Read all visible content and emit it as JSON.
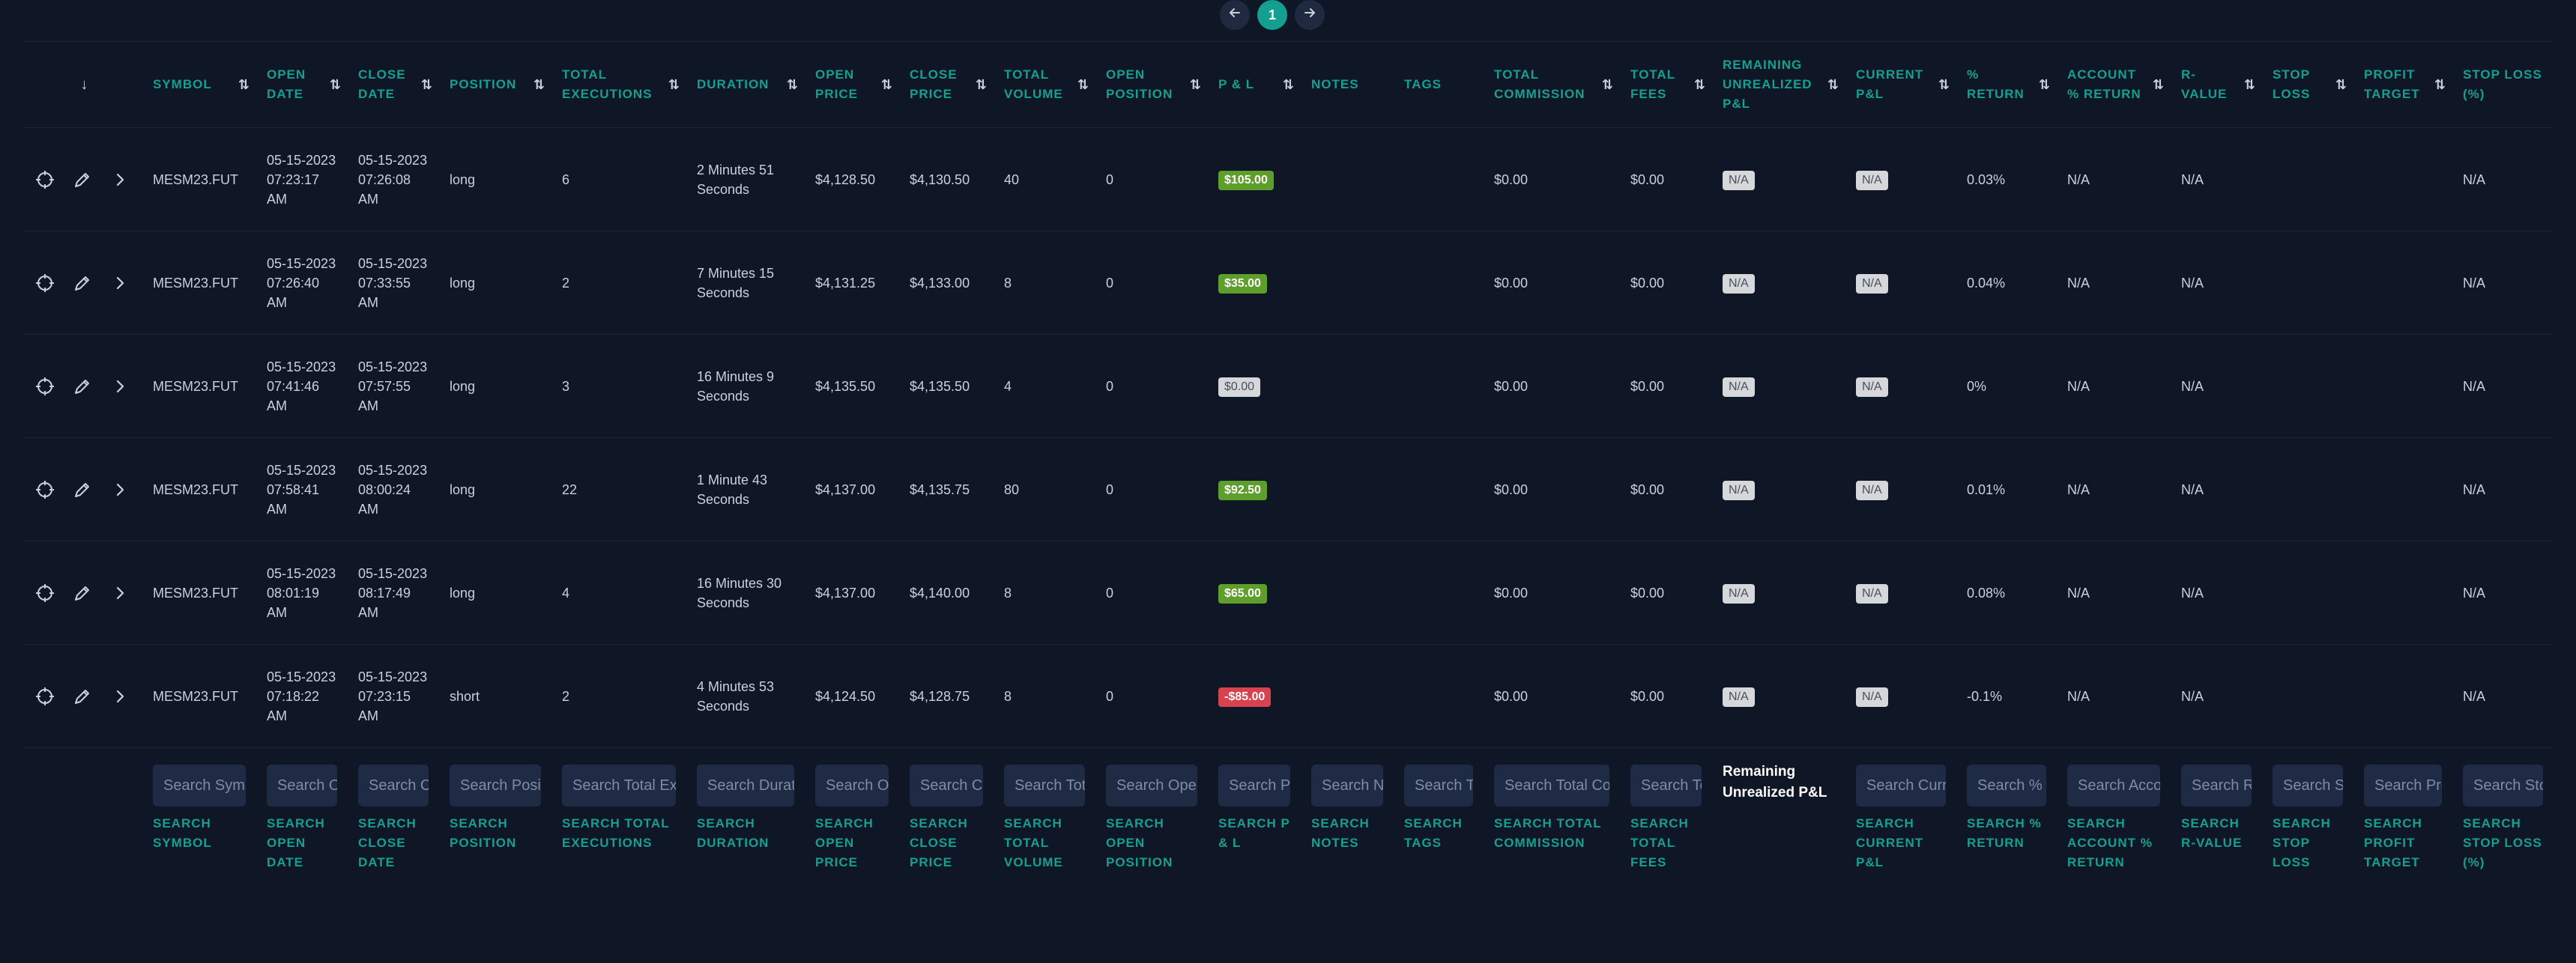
{
  "pagination": {
    "current": "1"
  },
  "sort_header_arrow": "↓",
  "columns": [
    {
      "key": "symbol",
      "label": "SYMBOL",
      "sortable": true,
      "search_placeholder": "Search Symbol",
      "search_label": "SEARCH SYMBOL"
    },
    {
      "key": "open_date",
      "label": "OPEN DATE",
      "sortable": true,
      "search_placeholder": "Search Open Date",
      "search_label": "SEARCH OPEN DATE"
    },
    {
      "key": "close_date",
      "label": "CLOSE DATE",
      "sortable": true,
      "search_placeholder": "Search Close Date",
      "search_label": "SEARCH CLOSE DATE"
    },
    {
      "key": "position",
      "label": "POSITION",
      "sortable": true,
      "search_placeholder": "Search Position",
      "search_label": "SEARCH POSITION"
    },
    {
      "key": "total_executions",
      "label": "TOTAL EXECUTIONS",
      "sortable": true,
      "search_placeholder": "Search Total Executions",
      "search_label": "SEARCH TOTAL EXECUTIONS"
    },
    {
      "key": "duration",
      "label": "DURATION",
      "sortable": true,
      "search_placeholder": "Search Duration",
      "search_label": "SEARCH DURATION"
    },
    {
      "key": "open_price",
      "label": "OPEN PRICE",
      "sortable": true,
      "search_placeholder": "Search Open Price",
      "search_label": "SEARCH OPEN PRICE"
    },
    {
      "key": "close_price",
      "label": "CLOSE PRICE",
      "sortable": true,
      "search_placeholder": "Search Close Price",
      "search_label": "SEARCH CLOSE PRICE"
    },
    {
      "key": "total_volume",
      "label": "TOTAL VOLUME",
      "sortable": true,
      "search_placeholder": "Search Total Volume",
      "search_label": "SEARCH TOTAL VOLUME"
    },
    {
      "key": "open_position",
      "label": "OPEN POSITION",
      "sortable": true,
      "search_placeholder": "Search Open Position",
      "search_label": "SEARCH OPEN POSITION"
    },
    {
      "key": "pnl",
      "label": "P & L",
      "sortable": true,
      "search_placeholder": "Search P & L",
      "search_label": "SEARCH P & L"
    },
    {
      "key": "notes",
      "label": "NOTES",
      "sortable": false,
      "search_placeholder": "Search Notes",
      "search_label": "SEARCH NOTES"
    },
    {
      "key": "tags",
      "label": "TAGS",
      "sortable": false,
      "search_placeholder": "Search Tags",
      "search_label": "SEARCH TAGS"
    },
    {
      "key": "total_commission",
      "label": "TOTAL COMMISSION",
      "sortable": true,
      "search_placeholder": "Search Total Commission",
      "search_label": "SEARCH TOTAL COMMISSION"
    },
    {
      "key": "total_fees",
      "label": "TOTAL FEES",
      "sortable": true,
      "search_placeholder": "Search Total Fees",
      "search_label": "SEARCH TOTAL FEES"
    },
    {
      "key": "remaining_unrealized_pnl",
      "label": "REMAINING UNREALIZED P&L",
      "sortable": true,
      "search_static": "Remaining Unrealized P&L"
    },
    {
      "key": "current_pnl",
      "label": "CURRENT P&L",
      "sortable": true,
      "search_placeholder": "Search Current P&L",
      "search_label": "SEARCH CURRENT P&L"
    },
    {
      "key": "pct_return",
      "label": "% RETURN",
      "sortable": true,
      "search_placeholder": "Search % Return",
      "search_label": "SEARCH % RETURN"
    },
    {
      "key": "account_pct_return",
      "label": "ACCOUNT % RETURN",
      "sortable": true,
      "search_placeholder": "Search Account % Return",
      "search_label": "SEARCH ACCOUNT % RETURN"
    },
    {
      "key": "r_value",
      "label": "R-VALUE",
      "sortable": true,
      "search_placeholder": "Search R-Value",
      "search_label": "SEARCH R-VALUE"
    },
    {
      "key": "stop_loss",
      "label": "STOP LOSS",
      "sortable": true,
      "search_placeholder": "Search Stop Loss",
      "search_label": "SEARCH STOP LOSS"
    },
    {
      "key": "profit_target",
      "label": "PROFIT TARGET",
      "sortable": true,
      "search_placeholder": "Search Profit Target",
      "search_label": "SEARCH PROFIT TARGET"
    },
    {
      "key": "stop_loss_pct",
      "label": "STOP LOSS (%)",
      "sortable": false,
      "search_placeholder": "Search Stop Loss (%)",
      "search_label": "SEARCH STOP LOSS (%)"
    }
  ],
  "rows": [
    {
      "symbol": "MESM23.FUT",
      "open_date": "05-15-2023 07:23:17 AM",
      "close_date": "05-15-2023 07:26:08 AM",
      "position": "long",
      "total_executions": "6",
      "duration": "2 Minutes 51 Seconds",
      "open_price": "$4,128.50",
      "close_price": "$4,130.50",
      "total_volume": "40",
      "open_position": "0",
      "pnl": "$105.00",
      "pnl_sign": "pos",
      "notes": "",
      "tags": "",
      "total_commission": "$0.00",
      "total_fees": "$0.00",
      "remaining_unrealized_pnl": "N/A",
      "current_pnl": "N/A",
      "pct_return": "0.03%",
      "account_pct_return": "N/A",
      "r_value": "N/A",
      "stop_loss": "",
      "profit_target": "",
      "stop_loss_pct": "N/A"
    },
    {
      "symbol": "MESM23.FUT",
      "open_date": "05-15-2023 07:26:40 AM",
      "close_date": "05-15-2023 07:33:55 AM",
      "position": "long",
      "total_executions": "2",
      "duration": "7 Minutes 15 Seconds",
      "open_price": "$4,131.25",
      "close_price": "$4,133.00",
      "total_volume": "8",
      "open_position": "0",
      "pnl": "$35.00",
      "pnl_sign": "pos",
      "notes": "",
      "tags": "",
      "total_commission": "$0.00",
      "total_fees": "$0.00",
      "remaining_unrealized_pnl": "N/A",
      "current_pnl": "N/A",
      "pct_return": "0.04%",
      "account_pct_return": "N/A",
      "r_value": "N/A",
      "stop_loss": "",
      "profit_target": "",
      "stop_loss_pct": "N/A"
    },
    {
      "symbol": "MESM23.FUT",
      "open_date": "05-15-2023 07:41:46 AM",
      "close_date": "05-15-2023 07:57:55 AM",
      "position": "long",
      "total_executions": "3",
      "duration": "16 Minutes 9 Seconds",
      "open_price": "$4,135.50",
      "close_price": "$4,135.50",
      "total_volume": "4",
      "open_position": "0",
      "pnl": "$0.00",
      "pnl_sign": "zero",
      "notes": "",
      "tags": "",
      "total_commission": "$0.00",
      "total_fees": "$0.00",
      "remaining_unrealized_pnl": "N/A",
      "current_pnl": "N/A",
      "pct_return": "0%",
      "account_pct_return": "N/A",
      "r_value": "N/A",
      "stop_loss": "",
      "profit_target": "",
      "stop_loss_pct": "N/A"
    },
    {
      "symbol": "MESM23.FUT",
      "open_date": "05-15-2023 07:58:41 AM",
      "close_date": "05-15-2023 08:00:24 AM",
      "position": "long",
      "total_executions": "22",
      "duration": "1 Minute 43 Seconds",
      "open_price": "$4,137.00",
      "close_price": "$4,135.75",
      "total_volume": "80",
      "open_position": "0",
      "pnl": "$92.50",
      "pnl_sign": "pos",
      "notes": "",
      "tags": "",
      "total_commission": "$0.00",
      "total_fees": "$0.00",
      "remaining_unrealized_pnl": "N/A",
      "current_pnl": "N/A",
      "pct_return": "0.01%",
      "account_pct_return": "N/A",
      "r_value": "N/A",
      "stop_loss": "",
      "profit_target": "",
      "stop_loss_pct": "N/A"
    },
    {
      "symbol": "MESM23.FUT",
      "open_date": "05-15-2023 08:01:19 AM",
      "close_date": "05-15-2023 08:17:49 AM",
      "position": "long",
      "total_executions": "4",
      "duration": "16 Minutes 30 Seconds",
      "open_price": "$4,137.00",
      "close_price": "$4,140.00",
      "total_volume": "8",
      "open_position": "0",
      "pnl": "$65.00",
      "pnl_sign": "pos",
      "notes": "",
      "tags": "",
      "total_commission": "$0.00",
      "total_fees": "$0.00",
      "remaining_unrealized_pnl": "N/A",
      "current_pnl": "N/A",
      "pct_return": "0.08%",
      "account_pct_return": "N/A",
      "r_value": "N/A",
      "stop_loss": "",
      "profit_target": "",
      "stop_loss_pct": "N/A"
    },
    {
      "symbol": "MESM23.FUT",
      "open_date": "05-15-2023 07:18:22 AM",
      "close_date": "05-15-2023 07:23:15 AM",
      "position": "short",
      "total_executions": "2",
      "duration": "4 Minutes 53 Seconds",
      "open_price": "$4,124.50",
      "close_price": "$4,128.75",
      "total_volume": "8",
      "open_position": "0",
      "pnl": "-$85.00",
      "pnl_sign": "neg",
      "notes": "",
      "tags": "",
      "total_commission": "$0.00",
      "total_fees": "$0.00",
      "remaining_unrealized_pnl": "N/A",
      "current_pnl": "N/A",
      "pct_return": "-0.1%",
      "account_pct_return": "N/A",
      "r_value": "N/A",
      "stop_loss": "",
      "profit_target": "",
      "stop_loss_pct": "N/A"
    }
  ],
  "icons": {
    "row_actions": [
      "target-icon",
      "pencil-icon",
      "chevron-right-icon"
    ]
  },
  "colors": {
    "background": "#0f1727",
    "accent": "#14a090",
    "positive": "#5e9e2a",
    "negative": "#d8424f",
    "input_bg": "#1f2b44"
  }
}
